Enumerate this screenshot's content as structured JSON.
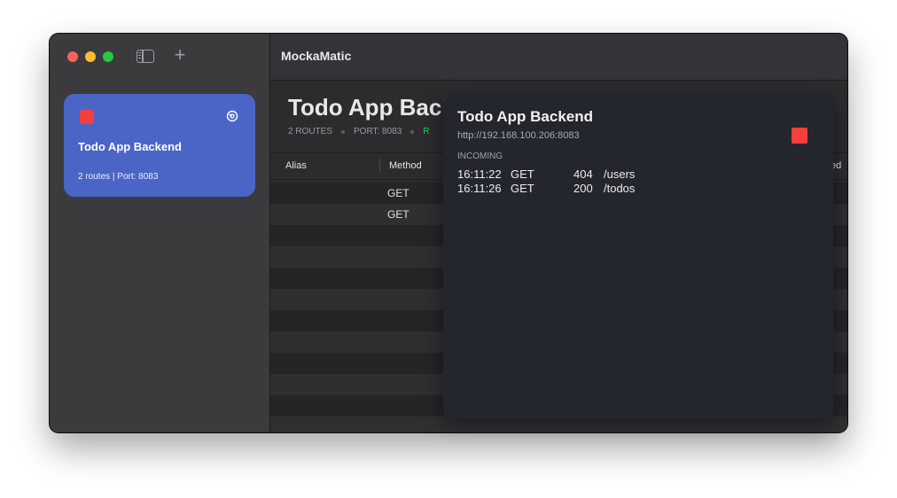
{
  "app": {
    "title": "MockaMatic"
  },
  "sidebar": {
    "servers": [
      {
        "name": "Todo App Backend",
        "summary": "2 routes | Port: 8083",
        "status": "running"
      }
    ]
  },
  "main": {
    "title": "Todo App Backend",
    "routes_count": "2 ROUTES",
    "port": "PORT: 8083",
    "status_label": "R",
    "table": {
      "columns": [
        "Alias",
        "Method",
        "ed"
      ],
      "rows": [
        {
          "alias": "",
          "method": "GET"
        },
        {
          "alias": "",
          "method": "GET"
        }
      ]
    }
  },
  "popover": {
    "title": "Todo App Backend",
    "url": "http://192.168.100.206:8083",
    "section": "INCOMING",
    "requests": [
      {
        "time": "16:11:22",
        "method": "GET",
        "status": "404",
        "path": "/users"
      },
      {
        "time": "16:11:26",
        "method": "GET",
        "status": "200",
        "path": "/todos"
      }
    ]
  },
  "colors": {
    "card": "#4b65c7",
    "stop": "#f43f3f",
    "running": "#35c759"
  },
  "icons": [
    "sidebar-toggle-icon",
    "plus-icon",
    "stop-icon",
    "settings-icon"
  ]
}
